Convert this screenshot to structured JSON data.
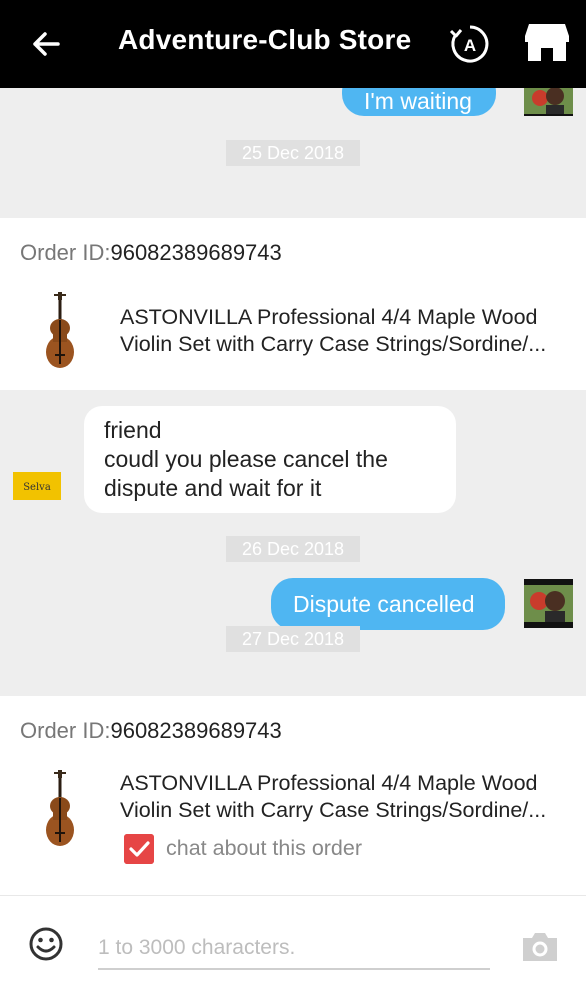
{
  "header": {
    "title": "Adventure-Club Store",
    "back_icon": "back-arrow-icon",
    "translate_icon": "translate-icon",
    "translate_glyph": "A",
    "store_icon": "store-icon"
  },
  "messages": {
    "top_outgoing": "I'm waiting",
    "date_1": "25 Dec 2018",
    "order_1": {
      "label": "Order ID:",
      "id": "96082389689743",
      "name_line1": "ASTONVILLA Professional 4/4 Maple Wood",
      "name_line2": "Violin Set with Carry Case Strings/Sordine/..."
    },
    "incoming": {
      "avatar_text": "Selva",
      "line1": "friend",
      "line2": "coudl you please cancel the",
      "line3": "dispute and wait for it"
    },
    "date_2": "26 Dec 2018",
    "outgoing_2": "Dispute cancelled",
    "date_3": "27 Dec 2018",
    "order_2": {
      "label": "Order ID:",
      "id": "96082389689743",
      "name_line1": "ASTONVILLA Professional 4/4 Maple Wood",
      "name_line2": "Violin Set with Carry Case Strings/Sordine/...",
      "checkbox_label": "chat about this order",
      "checkbox_checked": true
    }
  },
  "input_bar": {
    "placeholder": "1 to 3000 characters.",
    "emoji_icon": "emoji-icon",
    "camera_icon": "camera-icon"
  },
  "colors": {
    "header_bg": "#000000",
    "outgoing_bubble": "#4fb6f2",
    "incoming_bubble": "#ffffff",
    "checkbox": "#e64545",
    "chat_bg": "#eeeeee"
  }
}
